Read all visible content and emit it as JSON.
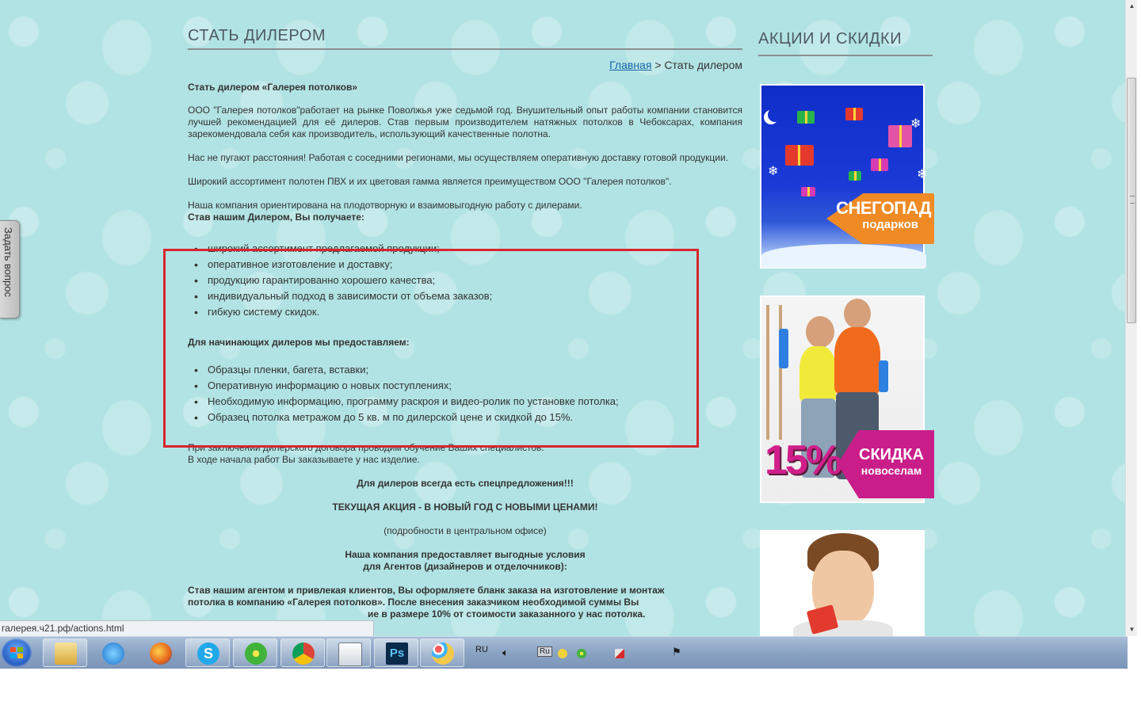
{
  "page": {
    "title": "СТАТЬ ДИЛЕРОМ",
    "breadcrumb": {
      "home": "Главная",
      "separator": ">",
      "current": "Стать дилером"
    },
    "intro_heading": "Стать дилером «Галерея потолков»",
    "paragraphs": [
      "ООО \"Галерея потолков\"работает на рынке Поволжья уже седьмой год. Внушительный опыт работы  компании становится лучшей рекомендацией для её дилеров. Став первым производителем натяжных потолков  в Чебоксарах, компания зарекомендовала себя как производитель, использующий качественные полотна.",
      "Нас не пугают расстояния! Работая с соседними регионами, мы осуществляем оперативную доставку готовой продукции.",
      "Широкий ассортимент полотен ПВХ и их цветовая гамма является преимуществом ООО \"Галерея потолков\".",
      "Наша компания ориентирована на плодотворную и взаимовыгодную работу с дилерами."
    ],
    "benefits_heading": "Став нашим Дилером, Вы получаете:",
    "benefits": [
      "широкий ассортимент предлагаемой продукции;",
      "оперативное изготовление и доставку;",
      "продукцию гарантированно хорошего качества;",
      "индивидуальный подход в зависимости от объема заказов;",
      "гибкую систему скидок."
    ],
    "beginners_heading": "Для начинающих дилеров мы предоставляем:",
    "beginners": [
      "Образцы пленки, багета, вставки;",
      "Оперативную информацию о новых поступлениях;",
      "Необходимую информацию, программу раскроя и видео-ролик  по установке потолка;",
      "Образец потолка метражом до 5 кв. м по дилерской цене и скидкой до 15%."
    ],
    "training_line1": "При заключении дилерского договора проводим обучение Ваших специалистов.",
    "training_line2": "В ходе начала работ Вы заказываете у нас изделие.",
    "special": "Для дилеров всегда есть спецпредложения!!!",
    "promo": "ТЕКУЩАЯ АКЦИЯ - В НОВЫЙ ГОД С НОВЫМИ ЦЕНАМИ!",
    "promo_note": "(подробности в центральном офисе)",
    "agents_line1": "Наша компания предоставляет выгодные условия",
    "agents_line2": "для Агентов (дизайнеров и отделочников):",
    "agents_text_line1": "Став нашим агентом и привлекая клиентов, Вы оформляете бланк заказа на изготовление и монтаж",
    "agents_text_line2": "потолка в компанию «Галерея потолков». После внесения заказчиком необходимой суммы Вы",
    "agents_text_line3": "ие в размере 10% от стоимости заказанного у нас потолка."
  },
  "side_tab": {
    "label": "Задать вопрос"
  },
  "sidebar": {
    "title": "АКЦИИ И СКИДКИ",
    "banner1": {
      "title": "СНЕГОПАД",
      "subtitle": "подарков"
    },
    "banner2": {
      "percent": "15%",
      "title": "СКИДКА",
      "subtitle": "новоселам"
    }
  },
  "status_bar": {
    "url": "галерея.ч21.рф/actions.html"
  },
  "taskbar": {
    "apps": [
      "start-button",
      "explorer",
      "ie",
      "firefox",
      "skype",
      "icq",
      "chrome",
      "clipboard",
      "photoshop",
      "paint"
    ],
    "language": "RU",
    "keyboard": "Ru"
  },
  "colors": {
    "background": "#b2e3e4",
    "heading": "#4e5a62",
    "link": "#1565a8",
    "highlight_border": "#d8252c",
    "banner1_arrow": "#f08a24",
    "banner2_arrow": "#c91d8a"
  }
}
